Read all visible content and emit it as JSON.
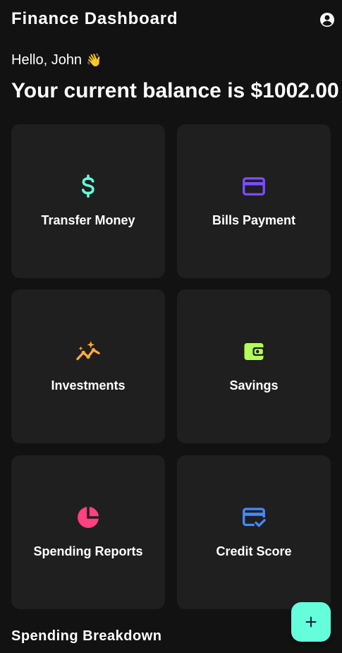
{
  "header": {
    "title": "Finance Dashboard",
    "account_icon": "account-circle-icon"
  },
  "greeting": {
    "text": "Hello, John",
    "emoji": "👋"
  },
  "balance": {
    "text": "Your current balance is $1002.00"
  },
  "tiles": [
    {
      "label": "Transfer Money",
      "icon": "dollar-icon",
      "color": "#64ffda"
    },
    {
      "label": "Bills Payment",
      "icon": "credit-card-icon",
      "color": "#7c4dff"
    },
    {
      "label": "Investments",
      "icon": "trending-up-sparkle-icon",
      "color": "#ffab40"
    },
    {
      "label": "Savings",
      "icon": "wallet-icon",
      "color": "#b2ff59"
    },
    {
      "label": "Spending Reports",
      "icon": "pie-chart-icon",
      "color": "#ff4081"
    },
    {
      "label": "Credit Score",
      "icon": "card-check-icon",
      "color": "#448aff"
    }
  ],
  "section": {
    "title": "Spending Breakdown"
  },
  "fab": {
    "icon": "plus-icon",
    "color": "#64ffda"
  }
}
